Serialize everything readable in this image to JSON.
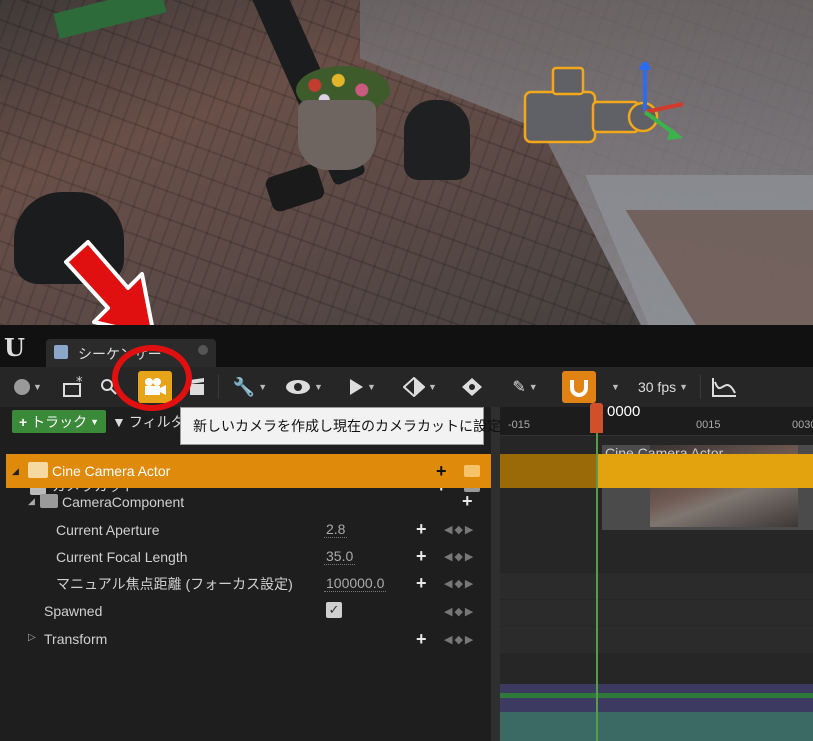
{
  "app": {
    "tab_title": "シーケンサー",
    "logo": "U"
  },
  "toolbar": {
    "fps": "30 fps",
    "tooltip": "新しいカメラを作成し現在のカメラカットに設定"
  },
  "outliner": {
    "add_track_label": "トラック",
    "filter_label": "フィルタ",
    "rows": {
      "camera_cut": "カメラカット",
      "cine_camera_actor": "Cine Camera Actor",
      "camera_component": "CameraComponent",
      "current_aperture": {
        "label": "Current Aperture",
        "value": "2.8"
      },
      "current_focal_length": {
        "label": "Current Focal Length",
        "value": "35.0"
      },
      "manual_focus": {
        "label": "マニュアル焦点距離 (フォーカス設定)",
        "value": "100000.0"
      },
      "spawned": "Spawned",
      "transform": "Transform"
    }
  },
  "timeline": {
    "current_frame": "0000",
    "ticks": [
      "-015",
      "0015",
      "0030"
    ],
    "shot_label": "Cine Camera Actor"
  },
  "colors": {
    "accent_orange": "#e08a0b",
    "track_gold": "#e2a30f",
    "add_track_green": "#3a8a3a",
    "annotation_red": "#e01010"
  }
}
